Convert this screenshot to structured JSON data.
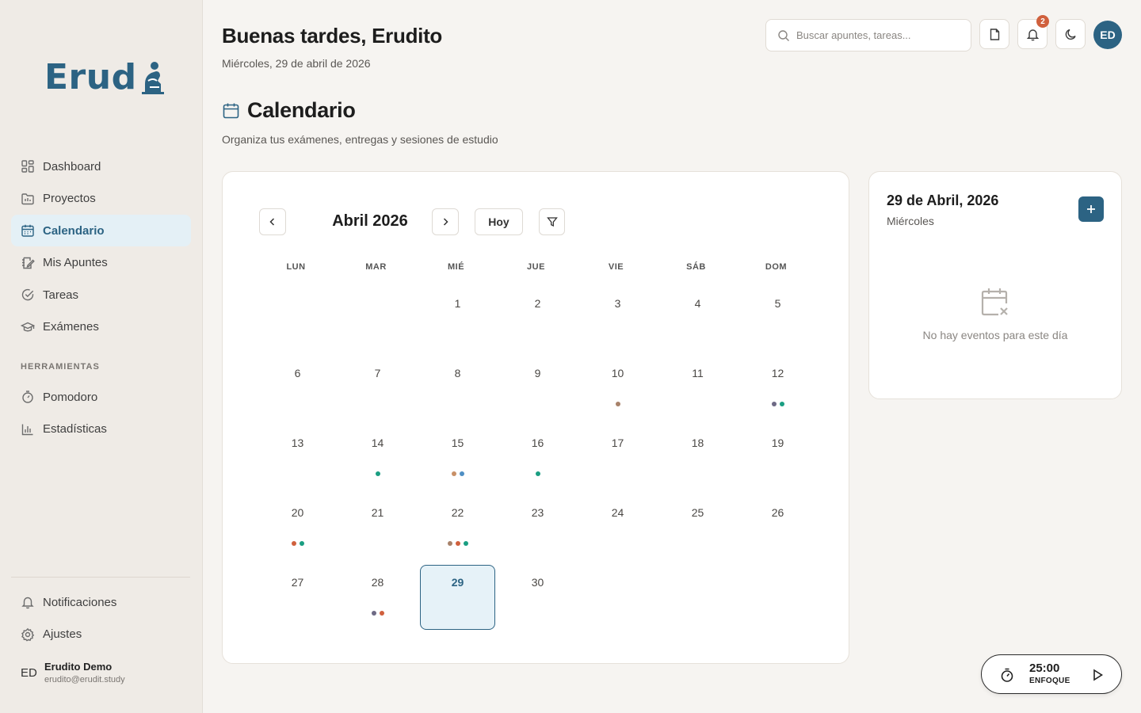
{
  "brand": {
    "logo_text": "Erud",
    "logo_mark": "thinker-figure-icon"
  },
  "sidebar": {
    "items": [
      {
        "label": "Dashboard",
        "icon": "dashboard-icon"
      },
      {
        "label": "Proyectos",
        "icon": "folder-icon"
      },
      {
        "label": "Calendario",
        "icon": "calendar-icon",
        "active": true
      },
      {
        "label": "Mis Apuntes",
        "icon": "notes-icon"
      },
      {
        "label": "Tareas",
        "icon": "check-circle-icon"
      },
      {
        "label": "Exámenes",
        "icon": "graduation-cap-icon"
      }
    ],
    "tools_label": "HERRAMIENTAS",
    "tools": [
      {
        "label": "Pomodoro",
        "icon": "timer-icon"
      },
      {
        "label": "Estadísticas",
        "icon": "bar-chart-icon"
      }
    ],
    "bottom": [
      {
        "label": "Notificaciones",
        "icon": "bell-icon"
      },
      {
        "label": "Ajustes",
        "icon": "gear-icon"
      }
    ],
    "user": {
      "initials": "ED",
      "name": "Erudito Demo",
      "email": "erudito@erudit.study"
    }
  },
  "header": {
    "greeting": "Buenas tardes, Erudito",
    "date": "Miércoles, 29 de abril de 2026",
    "search_placeholder": "Buscar apuntes, tareas...",
    "notifications_count": "2",
    "avatar_initials": "ED"
  },
  "page": {
    "title": "Calendario",
    "subtitle": "Organiza tus exámenes, entregas y sesiones de estudio"
  },
  "calendar": {
    "month_label": "Abril 2026",
    "today_label": "Hoy",
    "weekdays": [
      "LUN",
      "MAR",
      "MIÉ",
      "JUE",
      "VIE",
      "SÁB",
      "DOM"
    ],
    "first_weekday_index": 2,
    "days_in_month": 30,
    "selected_day": 29,
    "event_dots": {
      "10": [
        "#a8826a"
      ],
      "12": [
        "#6e6a85",
        "#1a9e82"
      ],
      "14": [
        "#1a9e82"
      ],
      "15": [
        "#c89067",
        "#4f8fc4"
      ],
      "16": [
        "#1a9e82"
      ],
      "20": [
        "#d0603d",
        "#1a9e82"
      ],
      "22": [
        "#a8826a",
        "#d0603d",
        "#1a9e82"
      ],
      "28": [
        "#6e6a85",
        "#d0603d"
      ]
    }
  },
  "day_panel": {
    "date": "29 de Abril, 2026",
    "weekday": "Miércoles",
    "empty_text": "No hay eventos para este día"
  },
  "pomodoro": {
    "time": "25:00",
    "label": "ENFOQUE"
  },
  "colors": {
    "accent": "#2c6383",
    "badge": "#d0603d",
    "selected_day_bg": "#e6f2f8"
  }
}
